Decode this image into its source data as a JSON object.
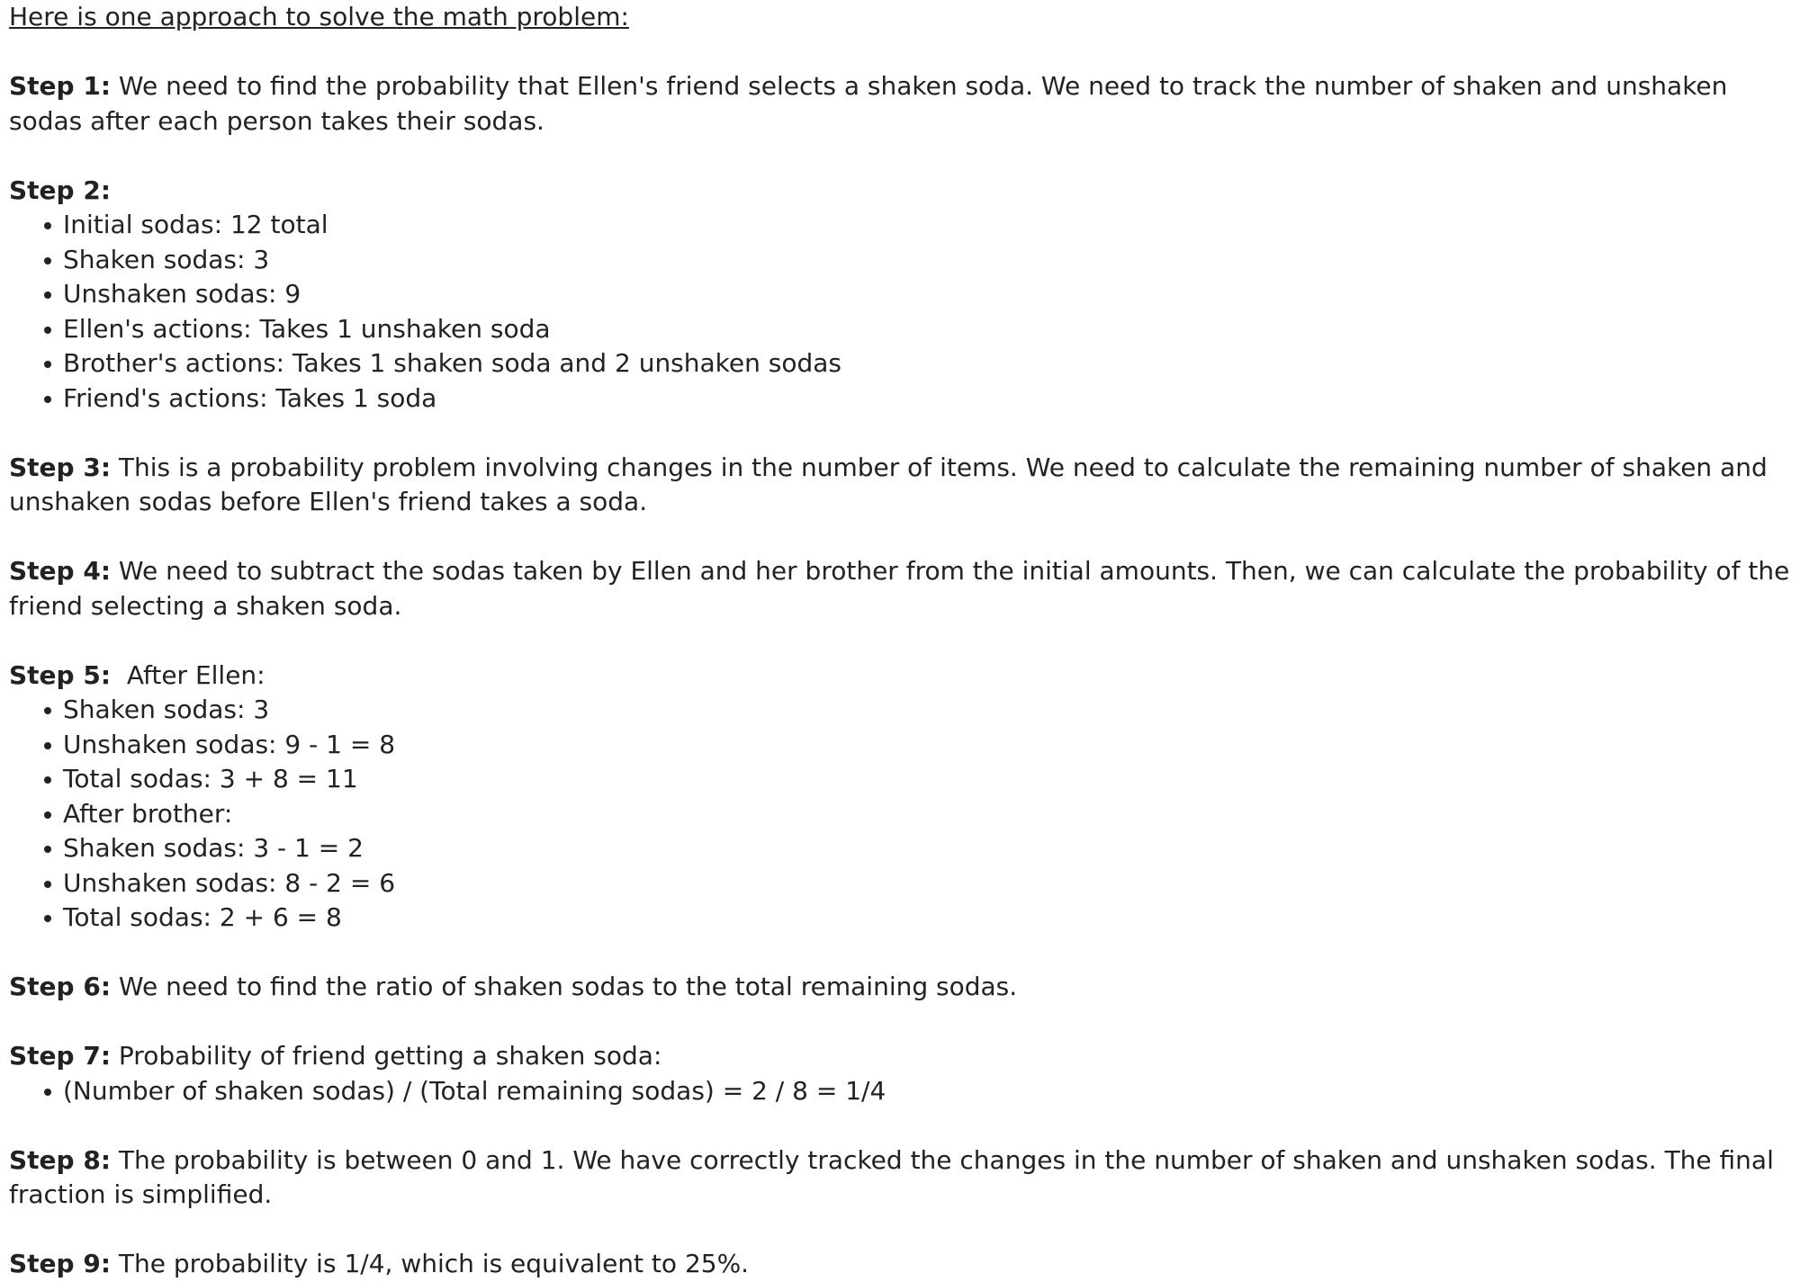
{
  "intro": "Here is one approach to solve the math problem:",
  "steps": [
    {
      "label": "Step 1:",
      "text": " We need to find the probability that Ellen's friend selects a shaken soda. We need to track the number of shaken and unshaken sodas after each person takes their sodas.",
      "bullets": []
    },
    {
      "label": "Step 2:",
      "text": "",
      "bullets": [
        "Initial sodas: 12 total",
        "Shaken sodas: 3",
        "Unshaken sodas: 9",
        "Ellen's actions: Takes 1 unshaken soda",
        "Brother's actions: Takes 1 shaken soda and 2 unshaken sodas",
        "Friend's actions: Takes 1 soda"
      ]
    },
    {
      "label": "Step 3:",
      "text": " This is a probability problem involving changes in the number of items. We need to calculate the remaining number of shaken and unshaken sodas before Ellen's friend takes a soda.",
      "bullets": []
    },
    {
      "label": "Step 4:",
      "text": " We need to subtract the sodas taken by Ellen and her brother from the initial amounts. Then, we can calculate the probability of the friend selecting a shaken soda.",
      "bullets": []
    },
    {
      "label": "Step 5:",
      "text": "  After Ellen:",
      "bullets": [
        "Shaken sodas: 3",
        "Unshaken sodas: 9 - 1 = 8",
        "Total sodas: 3 + 8 = 11",
        "After brother:",
        "Shaken sodas: 3 - 1 = 2",
        "Unshaken sodas: 8 - 2 = 6",
        "Total sodas: 2 + 6 = 8"
      ]
    },
    {
      "label": "Step 6:",
      "text": " We need to find the ratio of shaken sodas to the total remaining sodas.",
      "bullets": []
    },
    {
      "label": "Step 7:",
      "text": " Probability of friend getting a shaken soda:",
      "bullets": [
        "(Number of shaken sodas) / (Total remaining sodas) = 2 / 8 = 1/4"
      ]
    },
    {
      "label": "Step 8:",
      "text": " The probability is between 0 and 1. We have correctly tracked the changes in the number of shaken and unshaken sodas. The final fraction is simplified.",
      "bullets": []
    },
    {
      "label": "Step 9:",
      "text": " The probability is 1/4, which is equivalent to 25%.",
      "bullets": []
    }
  ]
}
